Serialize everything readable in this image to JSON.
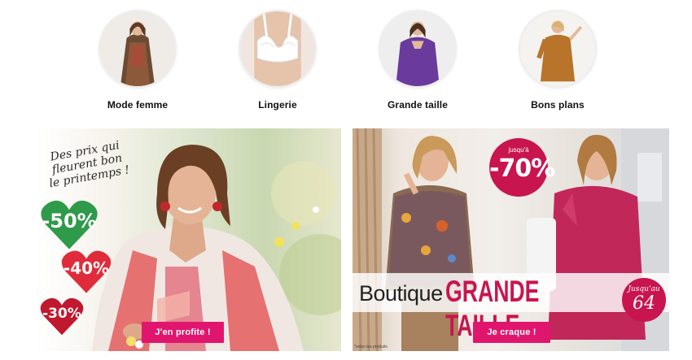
{
  "categories": [
    {
      "label": "Mode femme"
    },
    {
      "label": "Lingerie"
    },
    {
      "label": "Grande taille"
    },
    {
      "label": "Bons plans"
    }
  ],
  "banner_left": {
    "slogan_lines": [
      "Des prix qui",
      "fleurent bon",
      "le printemps !"
    ],
    "discounts": [
      "-50%",
      "-40%",
      "-30%"
    ],
    "cta_label": "J'en profite !"
  },
  "banner_right": {
    "badge_prefix": "jusqu'à",
    "badge_value": "-70%",
    "title_word": "Boutique",
    "title_highlight": "GRANDE TAILLE",
    "size_prefix": "Jusqu'au",
    "size_value": "64",
    "cta_label": "Je craque !",
    "legal": "*selon les produits"
  },
  "colors": {
    "accent_pink": "#e0166e",
    "badge_red": "#c8154f",
    "heart_green": "#2f9a4a",
    "heart_red": "#e02c3a",
    "heart_darkred": "#c0182f"
  }
}
